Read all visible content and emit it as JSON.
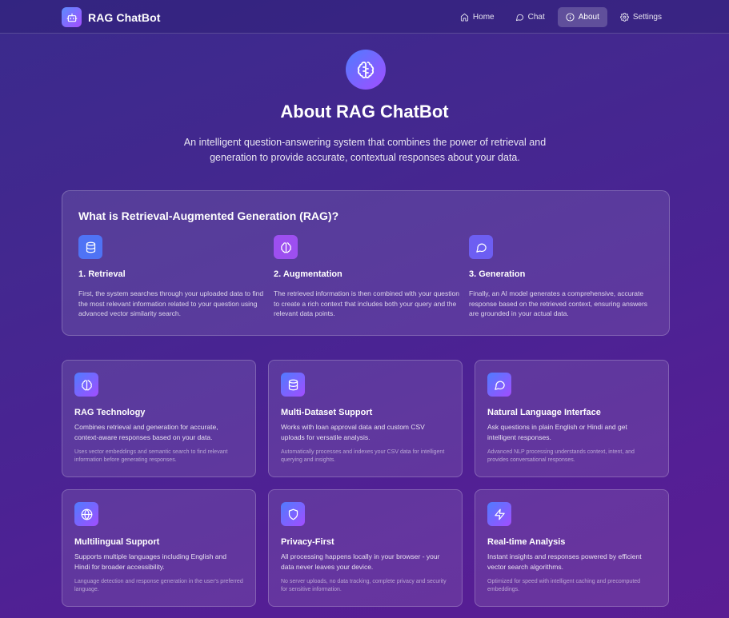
{
  "nav": {
    "brand": "RAG ChatBot",
    "links": [
      {
        "label": "Home",
        "icon": "home-icon"
      },
      {
        "label": "Chat",
        "icon": "chat-icon"
      },
      {
        "label": "About",
        "icon": "info-icon",
        "active": true
      },
      {
        "label": "Settings",
        "icon": "gear-icon"
      }
    ]
  },
  "hero": {
    "icon": "brain-icon",
    "title": "About RAG ChatBot",
    "description": "An intelligent question-answering system that combines the power of retrieval and generation to provide accurate, contextual responses about your data."
  },
  "rag": {
    "title": "What is Retrieval-Augmented Generation (RAG)?",
    "steps": [
      {
        "icon": "database-icon",
        "color": "#4f6ef7",
        "title": "1. Retrieval",
        "desc": "First, the system searches through your uploaded data to find the most relevant information related to your question using advanced vector similarity search."
      },
      {
        "icon": "brain-icon",
        "color": "#9b4df0",
        "title": "2. Augmentation",
        "desc": "The retrieved information is then combined with your question to create a rich context that includes both your query and the relevant data points."
      },
      {
        "icon": "chat-icon",
        "color": "#6a5cf0",
        "title": "3. Generation",
        "desc": "Finally, an AI model generates a comprehensive, accurate response based on the retrieved context, ensuring answers are grounded in your actual data."
      }
    ]
  },
  "features": [
    {
      "icon": "brain-icon",
      "title": "RAG Technology",
      "desc": "Combines retrieval and generation for accurate, context-aware responses based on your data.",
      "note": "Uses vector embeddings and semantic search to find relevant information before generating responses."
    },
    {
      "icon": "database-icon",
      "title": "Multi-Dataset Support",
      "desc": "Works with loan approval data and custom CSV uploads for versatile analysis.",
      "note": "Automatically processes and indexes your CSV data for intelligent querying and insights."
    },
    {
      "icon": "chat-icon",
      "title": "Natural Language Interface",
      "desc": "Ask questions in plain English or Hindi and get intelligent responses.",
      "note": "Advanced NLP processing understands context, intent, and provides conversational responses."
    },
    {
      "icon": "globe-icon",
      "title": "Multilingual Support",
      "desc": "Supports multiple languages including English and Hindi for broader accessibility.",
      "note": "Language detection and response generation in the user's preferred language."
    },
    {
      "icon": "shield-icon",
      "title": "Privacy-First",
      "desc": "All processing happens locally in your browser - your data never leaves your device.",
      "note": "No server uploads, no data tracking, complete privacy and security for sensitive information."
    },
    {
      "icon": "lightning-icon",
      "title": "Real-time Analysis",
      "desc": "Instant insights and responses powered by efficient vector search algorithms.",
      "note": "Optimized for speed with intelligent caching and precomputed embeddings."
    }
  ]
}
